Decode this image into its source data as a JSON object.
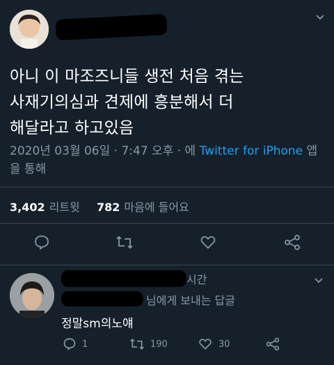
{
  "main_tweet": {
    "text": "아니 이 마조즈니들 생전 처음 겪는\n사재기의심과 견제에 흥분해서 더\n해달라고 하고있음",
    "timestamp": "2020년 03월 06일 · 7:47 오후 · 에 ",
    "source_link": "Twitter for iPhone",
    "source_suffix": " 앱을 통해",
    "retweet_count": "3,402",
    "retweet_label": "리트윗",
    "like_count": "782",
    "like_label": "마음에 들어요",
    "icons": [
      "reply-icon",
      "retweet-icon",
      "like-icon",
      "share-icon"
    ]
  },
  "reply": {
    "time_suffix": "시간",
    "replying_to": "님에게 보내는 답글",
    "text": "정말sm의노얘",
    "reply_count": "1",
    "retweet_count": "190",
    "like_count": "30"
  },
  "colors": {
    "background": "#15202b",
    "text_secondary": "#8899a6",
    "link": "#1da1f2",
    "divider": "#38444d"
  }
}
